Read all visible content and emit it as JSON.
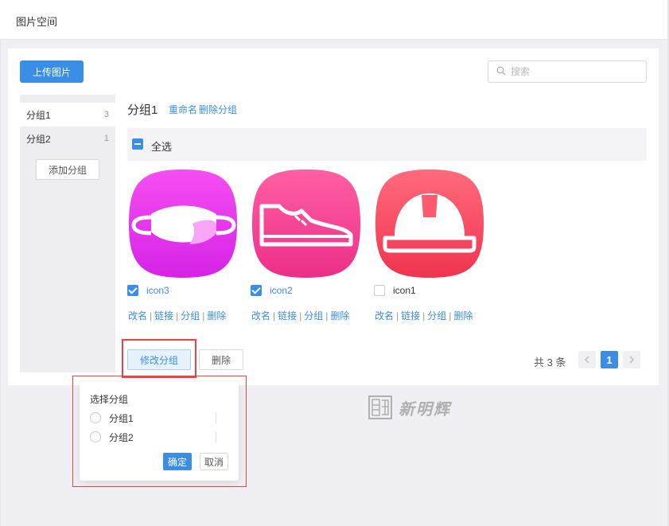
{
  "header": {
    "title": "图片空间"
  },
  "toolbar": {
    "upload_label": "上传图片",
    "search_placeholder": "搜索"
  },
  "sidebar": {
    "items": [
      {
        "label": "分组1",
        "count": "3"
      },
      {
        "label": "分组2",
        "count": "1"
      }
    ],
    "add_label": "添加分组"
  },
  "group": {
    "title": "分组1",
    "rename_label": "重命名",
    "delete_label": "删除分组"
  },
  "select_all_label": "全选",
  "images": [
    {
      "name": "icon3",
      "checked": true,
      "icon": "mask-icon",
      "color_top": "#f54ef2",
      "color_bottom": "#d623e6"
    },
    {
      "name": "icon2",
      "checked": true,
      "icon": "shoe-icon",
      "color_top": "#ff5fa3",
      "color_bottom": "#ec2f88"
    },
    {
      "name": "icon1",
      "checked": false,
      "icon": "helmet-icon",
      "color_top": "#ff6b7c",
      "color_bottom": "#f0344f"
    }
  ],
  "image_actions": {
    "rename": "改名",
    "link": "链接",
    "group": "分组",
    "delete": "删除"
  },
  "bottom": {
    "modify_group_label": "修改分组",
    "delete_label": "删除"
  },
  "pagination": {
    "total_text": "共 3 条",
    "current_page": "1",
    "prev_icon": "chevron-left-icon",
    "next_icon": "chevron-right-icon"
  },
  "popover": {
    "title": "选择分组",
    "options": [
      "分组1",
      "分组2"
    ],
    "ok_label": "确定",
    "cancel_label": "取消"
  },
  "watermark": {
    "text": "新明辉"
  },
  "colors": {
    "accent": "#3a8ee6",
    "highlight": "#e54545"
  }
}
